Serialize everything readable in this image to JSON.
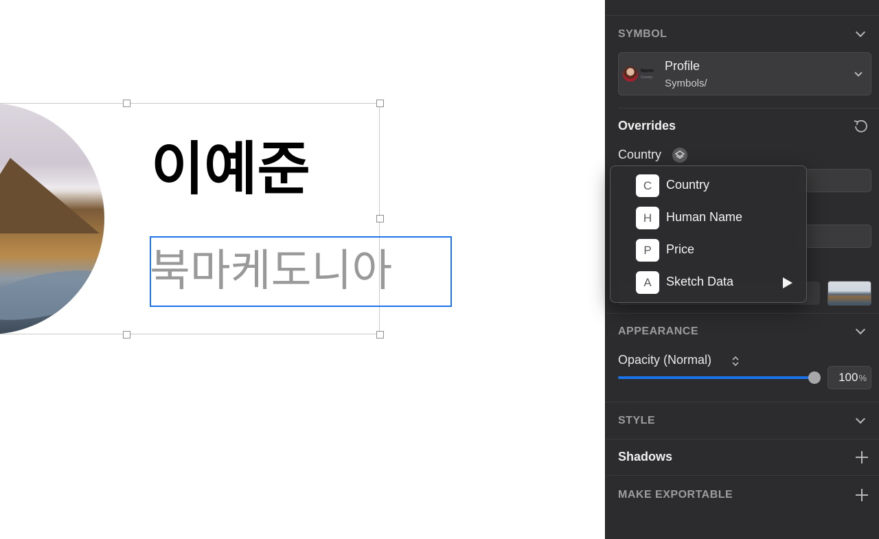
{
  "canvas": {
    "name_text": "이예준",
    "country_text": "북마케도니아"
  },
  "inspector": {
    "symbol_section": {
      "title": "SYMBOL"
    },
    "symbol_picker": {
      "thumb_title": "Name",
      "thumb_subtitle": "Country",
      "name": "Profile",
      "path": "Symbols/"
    },
    "overrides": {
      "title": "Overrides",
      "country_label": "Country"
    },
    "appearance": {
      "title": "APPEARANCE",
      "opacity_label": "Opacity (Normal)",
      "opacity_fraction": 1.0,
      "opacity_value": "100",
      "opacity_unit": "%"
    },
    "style": {
      "title": "STYLE"
    },
    "shadows": {
      "title": "Shadows"
    },
    "exportable": {
      "title": "MAKE EXPORTABLE"
    }
  },
  "override_menu": {
    "items": [
      {
        "letter": "C",
        "label": "Country",
        "has_submenu": false
      },
      {
        "letter": "H",
        "label": "Human Name",
        "has_submenu": false
      },
      {
        "letter": "P",
        "label": "Price",
        "has_submenu": false
      },
      {
        "letter": "A",
        "label": "Sketch Data",
        "has_submenu": true
      }
    ]
  },
  "colors": {
    "accent": "#1a73e8",
    "panel_bg": "#2c2c2e",
    "placeholder_text": "#999999"
  }
}
